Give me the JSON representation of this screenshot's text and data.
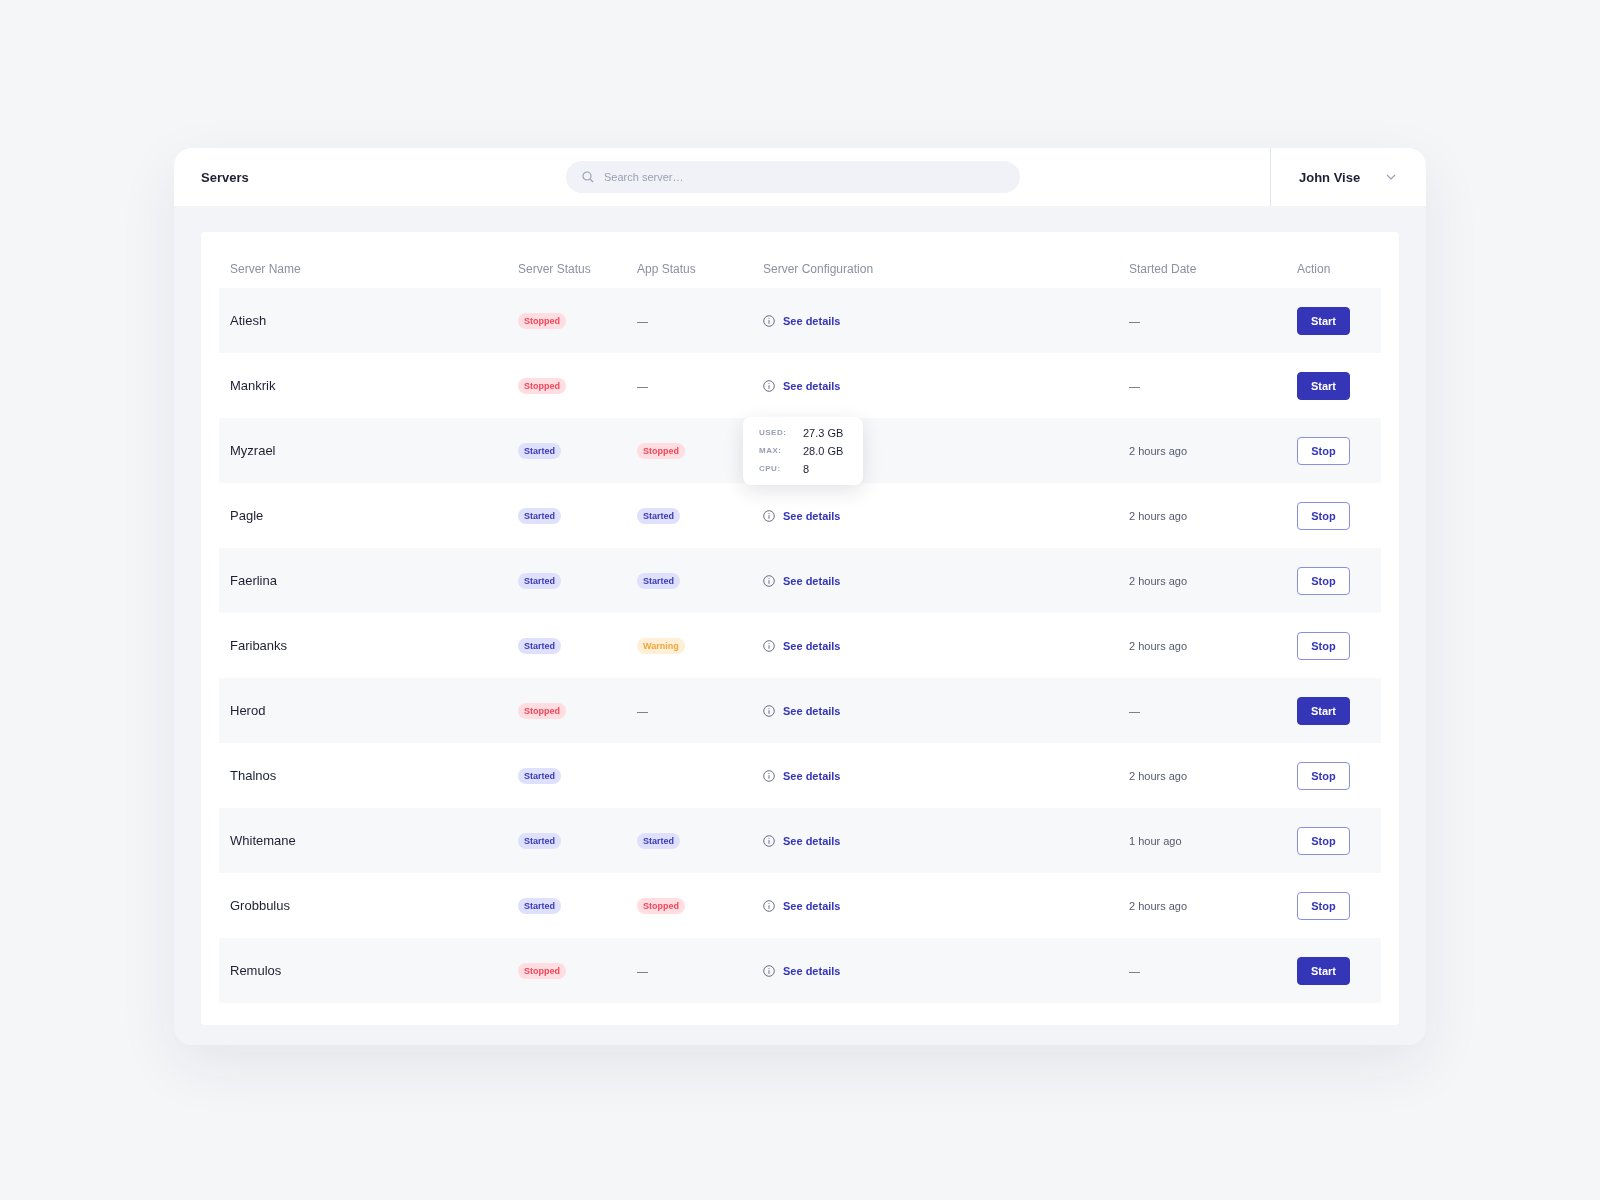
{
  "header": {
    "title": "Servers",
    "search": {
      "placeholder": "Search server…"
    },
    "user": {
      "name": "John Vise"
    }
  },
  "table": {
    "columns": [
      "Server Name",
      "Server Status",
      "App Status",
      "Server Configuration",
      "Started Date",
      "Action"
    ],
    "rows": [
      {
        "name": "Atiesh",
        "server_status": {
          "label": "Stopped",
          "kind": "stopped"
        },
        "app_status": {
          "label": "—",
          "kind": "none"
        },
        "config": "See details",
        "started": "—",
        "action": {
          "label": "Start",
          "kind": "start"
        }
      },
      {
        "name": "Mankrik",
        "server_status": {
          "label": "Stopped",
          "kind": "stopped"
        },
        "app_status": {
          "label": "—",
          "kind": "none"
        },
        "config": "See details",
        "started": "—",
        "action": {
          "label": "Start",
          "kind": "start"
        }
      },
      {
        "name": "Myzrael",
        "server_status": {
          "label": "Started",
          "kind": "started"
        },
        "app_status": {
          "label": "Stopped",
          "kind": "stopped"
        },
        "tooltip": [
          {
            "key": "USED:",
            "value": "27.3 GB"
          },
          {
            "key": "MAX:",
            "value": "28.0 GB"
          },
          {
            "key": "CPU:",
            "value": "8"
          }
        ],
        "started": "2 hours ago",
        "action": {
          "label": "Stop",
          "kind": "stop"
        }
      },
      {
        "name": "Pagle",
        "server_status": {
          "label": "Started",
          "kind": "started"
        },
        "app_status": {
          "label": "Started",
          "kind": "started"
        },
        "config": "See details",
        "started": "2 hours ago",
        "action": {
          "label": "Stop",
          "kind": "stop"
        }
      },
      {
        "name": "Faerlina",
        "server_status": {
          "label": "Started",
          "kind": "started"
        },
        "app_status": {
          "label": "Started",
          "kind": "started"
        },
        "config": "See details",
        "started": "2 hours ago",
        "action": {
          "label": "Stop",
          "kind": "stop"
        }
      },
      {
        "name": "Faribanks",
        "server_status": {
          "label": "Started",
          "kind": "started"
        },
        "app_status": {
          "label": "Warning",
          "kind": "warning"
        },
        "config": "See details",
        "started": "2 hours ago",
        "action": {
          "label": "Stop",
          "kind": "stop"
        }
      },
      {
        "name": "Herod",
        "server_status": {
          "label": "Stopped",
          "kind": "stopped"
        },
        "app_status": {
          "label": "—",
          "kind": "none"
        },
        "config": "See details",
        "started": "—",
        "action": {
          "label": "Start",
          "kind": "start"
        }
      },
      {
        "name": "Thalnos",
        "server_status": {
          "label": "Started",
          "kind": "started"
        },
        "config": "See details",
        "started": "2 hours ago",
        "action": {
          "label": "Stop",
          "kind": "stop"
        }
      },
      {
        "name": "Whitemane",
        "server_status": {
          "label": "Started",
          "kind": "started"
        },
        "app_status": {
          "label": "Started",
          "kind": "started"
        },
        "config": "See details",
        "started": "1 hour ago",
        "action": {
          "label": "Stop",
          "kind": "stop"
        }
      },
      {
        "name": "Grobbulus",
        "server_status": {
          "label": "Started",
          "kind": "started"
        },
        "app_status": {
          "label": "Stopped",
          "kind": "stopped"
        },
        "config": "See details",
        "started": "2 hours ago",
        "action": {
          "label": "Stop",
          "kind": "stop"
        }
      },
      {
        "name": "Remulos",
        "server_status": {
          "label": "Stopped",
          "kind": "stopped"
        },
        "app_status": {
          "label": "—",
          "kind": "none"
        },
        "config": "See details",
        "started": "—",
        "action": {
          "label": "Start",
          "kind": "start"
        }
      }
    ]
  }
}
